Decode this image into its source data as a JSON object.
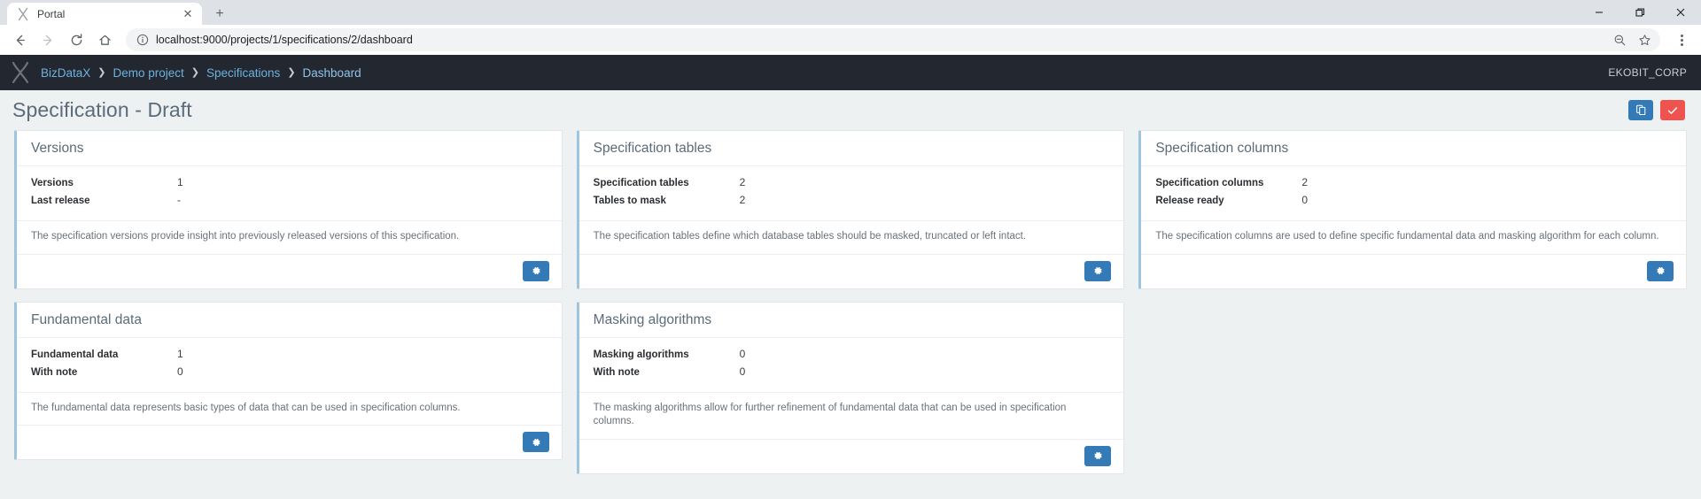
{
  "browser": {
    "tab": {
      "title": "Portal",
      "favicon_icon": "bizdatax-x-icon",
      "close_icon": "close-icon"
    },
    "new_tab_icon": "plus-icon",
    "window_controls": [
      {
        "name": "minimize",
        "icon": "minimize-icon"
      },
      {
        "name": "maximize",
        "icon": "restore-icon"
      },
      {
        "name": "close",
        "icon": "close-icon"
      }
    ],
    "toolbar": {
      "back_icon": "arrow-left-icon",
      "forward_icon": "arrow-right-icon",
      "reload_icon": "reload-icon",
      "home_icon": "home-icon",
      "info_icon": "info-circle-icon",
      "url": "localhost:9000/projects/1/specifications/2/dashboard",
      "zoom_icon": "zoom-out-icon",
      "bookmark_icon": "star-icon",
      "menu_icon": "three-dots-vertical-icon"
    }
  },
  "app": {
    "logo_icon": "bizdatax-logo-icon",
    "breadcrumb": [
      {
        "label": "BizDataX"
      },
      {
        "label": "Demo project"
      },
      {
        "label": "Specifications"
      },
      {
        "label": "Dashboard"
      }
    ],
    "breadcrumb_separator": "❯",
    "user": "EKOBIT_CORP",
    "page_title": "Specification - Draft",
    "header_actions": [
      {
        "name": "duplicate-specification-button",
        "icon": "copy-icon",
        "color": "#337ab7"
      },
      {
        "name": "confirm-specification-button",
        "icon": "check-icon",
        "color": "#ef5350"
      }
    ],
    "gear_icon": "gear-icon",
    "cards": [
      {
        "id": "versions",
        "title": "Versions",
        "stats": [
          {
            "label": "Versions",
            "value": "1"
          },
          {
            "label": "Last release",
            "value": "-"
          }
        ],
        "description": "The specification versions provide insight into previously released versions of this specification.",
        "action_icon": "gear-icon"
      },
      {
        "id": "specification-tables",
        "title": "Specification tables",
        "stats": [
          {
            "label": "Specification tables",
            "value": "2"
          },
          {
            "label": "Tables to mask",
            "value": "2"
          }
        ],
        "description": "The specification tables define which database tables should be masked, truncated or left intact.",
        "action_icon": "gear-icon"
      },
      {
        "id": "specification-columns",
        "title": "Specification columns",
        "stats": [
          {
            "label": "Specification columns",
            "value": "2"
          },
          {
            "label": "Release ready",
            "value": "0"
          }
        ],
        "description": "The specification columns are used to define specific fundamental data and masking algorithm for each column.",
        "action_icon": "gear-icon"
      },
      {
        "id": "fundamental-data",
        "title": "Fundamental data",
        "stats": [
          {
            "label": "Fundamental data",
            "value": "1"
          },
          {
            "label": "With note",
            "value": "0"
          }
        ],
        "description": "The fundamental data represents basic types of data that can be used in specification columns.",
        "action_icon": "gear-icon"
      },
      {
        "id": "masking-algorithms",
        "title": "Masking algorithms",
        "stats": [
          {
            "label": "Masking algorithms",
            "value": "0"
          },
          {
            "label": "With note",
            "value": "0"
          }
        ],
        "description": "The masking algorithms allow for further refinement of fundamental data that can be used in specification columns.",
        "action_icon": "gear-icon"
      }
    ]
  },
  "colors": {
    "navbar_bg": "#23272f",
    "page_bg": "#edf1f2",
    "accent_blue": "#337ab7",
    "accent_red": "#ef5350",
    "card_accent": "#9ec5de",
    "link_blue": "#6cb2e0"
  }
}
